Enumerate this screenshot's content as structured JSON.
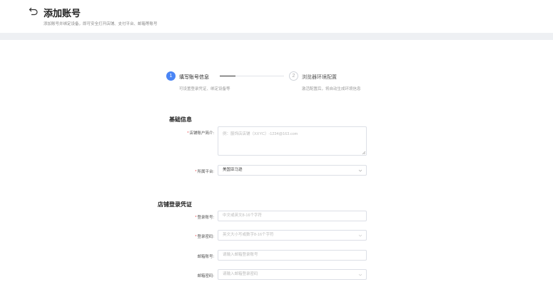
{
  "header": {
    "title": "添加账号",
    "subtitle": "添加账号并绑定设备，即可安全打开店铺、支付平台、邮箱等账号"
  },
  "steps": [
    {
      "number": "1",
      "title": "填写账号信息",
      "desc": "可设置登录凭证、绑定设备等",
      "active": true
    },
    {
      "number": "2",
      "title": "浏览器环境配置",
      "desc": "激活配置后，将自动生成环境信息",
      "active": false
    }
  ],
  "basic": {
    "title": "基础信息",
    "fields": [
      {
        "label": "店铺账户简介:",
        "required": true,
        "placeholder": "例：服饰店店铺（XXYC）-1234@163.com",
        "value": ""
      },
      {
        "label": "所属平台:",
        "required": true,
        "value": "美国亚马逊"
      }
    ]
  },
  "credentials": {
    "title": "店铺登录凭证",
    "fields": [
      {
        "label": "登录账号:",
        "required": true,
        "placeholder": "中文或英文8-16个字符"
      },
      {
        "label": "登录密码:",
        "required": true,
        "placeholder": "英文大小写或数字8-16个字符"
      },
      {
        "label": "邮箱账号:",
        "required": false,
        "placeholder": "请输入邮箱登录账号"
      },
      {
        "label": "邮箱密码:",
        "required": false,
        "placeholder": "请输入邮箱登录密码"
      }
    ]
  },
  "colors": {
    "accent": "#4a85f5",
    "required": "#e5484d"
  }
}
